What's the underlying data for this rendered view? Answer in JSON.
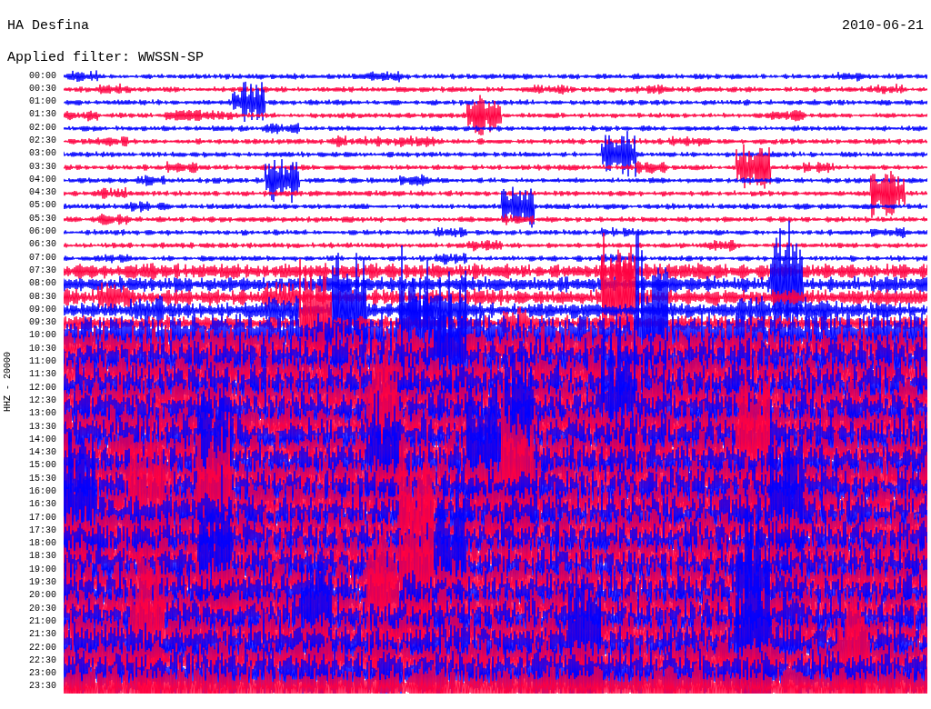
{
  "header": {
    "station": "HA Desfina",
    "date": "2010-06-21",
    "filter": "Applied filter: WWSSN-SP"
  },
  "plot": {
    "channel_label": "HHZ - 20000",
    "time_labels": [
      "00:00",
      "00:30",
      "01:00",
      "01:30",
      "02:00",
      "02:30",
      "03:00",
      "03:30",
      "04:00",
      "04:30",
      "05:00",
      "05:30",
      "06:00",
      "06:30",
      "07:00",
      "07:30",
      "08:00",
      "08:30",
      "09:00",
      "09:30",
      "10:00",
      "10:30",
      "11:00",
      "11:30",
      "12:00",
      "12:30",
      "13:00",
      "13:30",
      "14:00",
      "14:30",
      "15:00",
      "15:30",
      "16:00",
      "16:30",
      "17:00",
      "17:30",
      "18:00",
      "18:30",
      "19:00",
      "19:30",
      "20:00",
      "20:30",
      "21:00",
      "21:30",
      "22:00",
      "22:30",
      "23:00",
      "23:30"
    ]
  }
}
